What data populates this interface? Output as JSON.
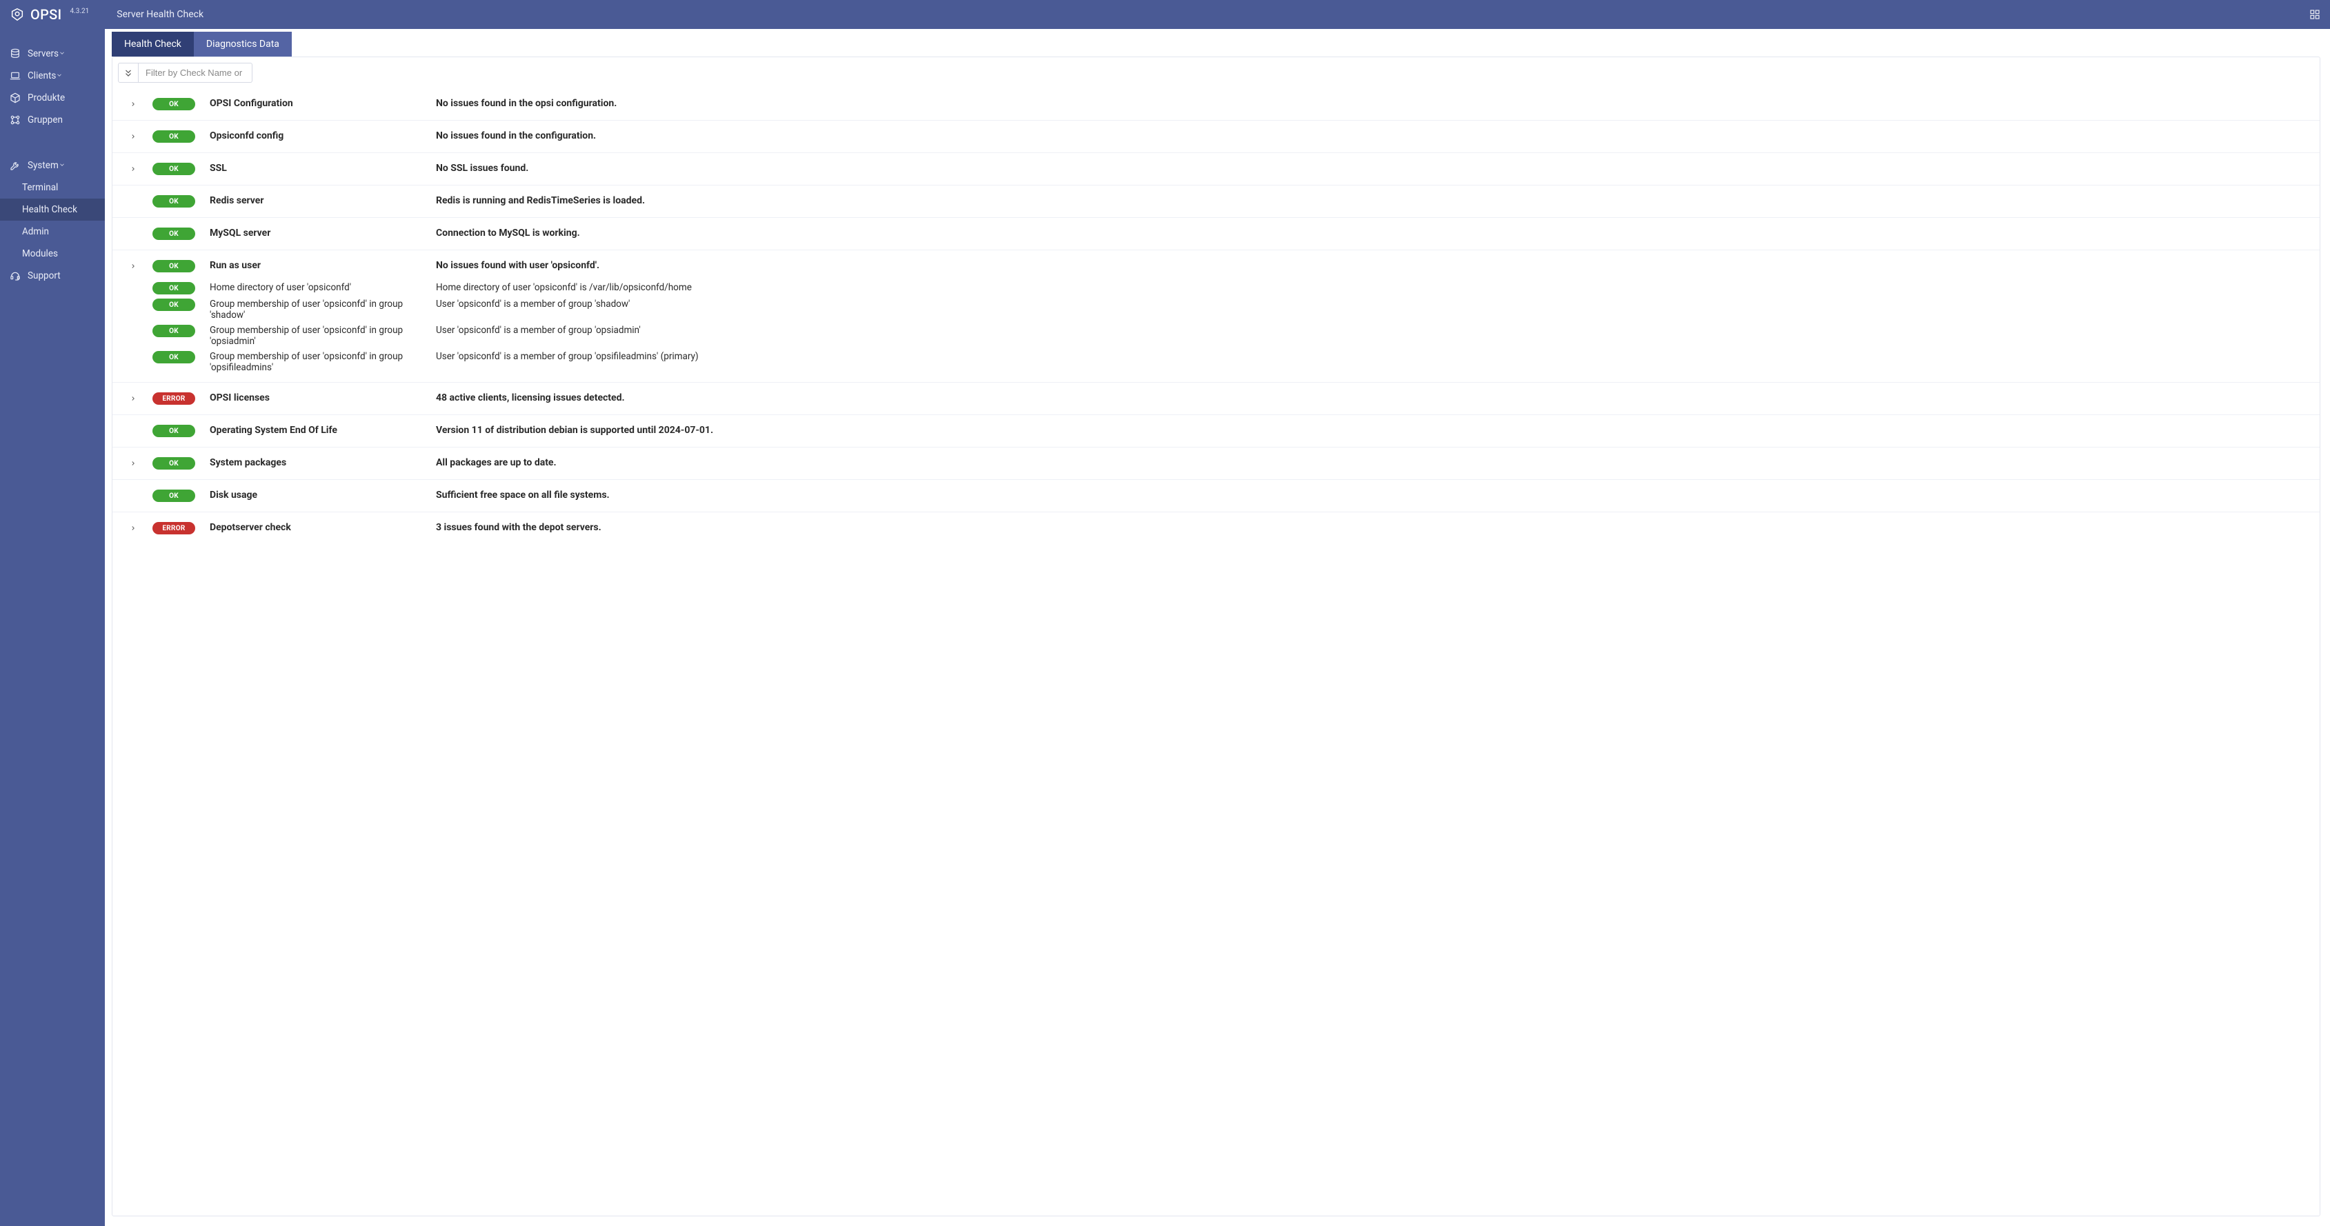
{
  "brand": {
    "name": "OPSI",
    "version": "4.3.21"
  },
  "page_title": "Server Health Check",
  "sidebar": {
    "items": [
      {
        "icon": "database",
        "label": "Servers",
        "expandable": true
      },
      {
        "icon": "laptop",
        "label": "Clients",
        "expandable": true
      },
      {
        "icon": "cube",
        "label": "Produkte",
        "expandable": false
      },
      {
        "icon": "sitemap",
        "label": "Gruppen",
        "expandable": false
      }
    ],
    "system": {
      "icon": "tools",
      "label": "System",
      "expandable": true,
      "children": [
        {
          "label": "Terminal"
        },
        {
          "label": "Health Check",
          "active": true
        },
        {
          "label": "Admin"
        },
        {
          "label": "Modules"
        }
      ]
    },
    "support": {
      "icon": "headset",
      "label": "Support"
    }
  },
  "tabs": [
    {
      "label": "Health Check",
      "active": true
    },
    {
      "label": "Diagnostics Data",
      "active": false
    }
  ],
  "filter": {
    "placeholder": "Filter by Check Name or Stat"
  },
  "status_labels": {
    "ok": "OK",
    "error": "ERROR"
  },
  "checks": [
    {
      "expandable": true,
      "status": "ok",
      "name": "OPSI Configuration",
      "message": "No issues found in the opsi configuration."
    },
    {
      "expandable": true,
      "status": "ok",
      "name": "Opsiconfd config",
      "message": "No issues found in the configuration."
    },
    {
      "expandable": true,
      "status": "ok",
      "name": "SSL",
      "message": "No SSL issues found."
    },
    {
      "expandable": false,
      "status": "ok",
      "name": "Redis server",
      "message": "Redis is running and RedisTimeSeries is loaded."
    },
    {
      "expandable": false,
      "status": "ok",
      "name": "MySQL server",
      "message": "Connection to MySQL is working."
    },
    {
      "expandable": true,
      "status": "ok",
      "name": "Run as user",
      "message": "No issues found with user 'opsiconfd'.",
      "sub": [
        {
          "status": "ok",
          "name": "Home directory of user 'opsiconfd'",
          "message": "Home directory of user 'opsiconfd' is /var/lib/opsiconfd/home"
        },
        {
          "status": "ok",
          "name": "Group membership of user 'opsiconfd' in group 'shadow'",
          "message": "User 'opsiconfd' is a member of group 'shadow'"
        },
        {
          "status": "ok",
          "name": "Group membership of user 'opsiconfd' in group 'opsiadmin'",
          "message": "User 'opsiconfd' is a member of group 'opsiadmin'"
        },
        {
          "status": "ok",
          "name": "Group membership of user 'opsiconfd' in group 'opsifileadmins'",
          "message": "User 'opsiconfd' is a member of group 'opsifileadmins' (primary)"
        }
      ]
    },
    {
      "expandable": true,
      "status": "error",
      "name": "OPSI licenses",
      "message": "48 active clients, licensing issues detected."
    },
    {
      "expandable": false,
      "status": "ok",
      "name": "Operating System End Of Life",
      "message": "Version 11 of distribution debian is supported until 2024-07-01."
    },
    {
      "expandable": true,
      "status": "ok",
      "name": "System packages",
      "message": "All packages are up to date."
    },
    {
      "expandable": false,
      "status": "ok",
      "name": "Disk usage",
      "message": "Sufficient free space on all file systems."
    },
    {
      "expandable": true,
      "status": "error",
      "name": "Depotserver check",
      "message": "3 issues found with the depot servers."
    }
  ]
}
